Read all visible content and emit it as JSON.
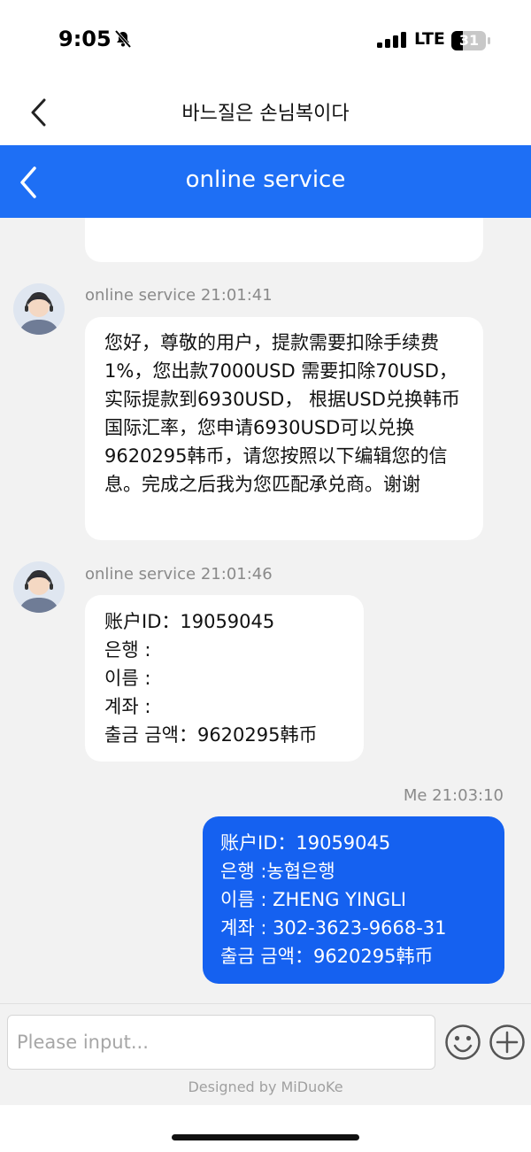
{
  "status_bar": {
    "time": "9:05",
    "network": "LTE",
    "battery": "31"
  },
  "title_bar": {
    "title": "바느질은 손님복이다"
  },
  "chat_header": {
    "title": "online service"
  },
  "messages": [
    {
      "sender": "online service",
      "time": "21:01:41",
      "text": "您好，尊敬的用户，提款需要扣除手续费1%，您出款7000USD 需要扣除70USD，实际提款到6930USD， 根据USD兑换韩币国际汇率，您申请6930USD可以兑换9620295韩币，请您按照以下编辑您的信息。完成之后我为您匹配承兑商。谢谢"
    },
    {
      "sender": "online service",
      "time": "21:01:46",
      "lines": [
        "账户ID：19059045",
        "은행 :",
        "이름 :",
        "계좌 :",
        "출금 금액：9620295韩币"
      ]
    },
    {
      "sender": "Me",
      "time": "21:03:10",
      "lines": [
        "账户ID：19059045",
        "은행 :농협은행",
        "이름 : ZHENG YINGLI",
        "계좌 : 302-3623-9668-31",
        "출금 금액：9620295韩币"
      ]
    }
  ],
  "input": {
    "placeholder": "Please input..."
  },
  "footer": "Designed by MiDuoKe"
}
